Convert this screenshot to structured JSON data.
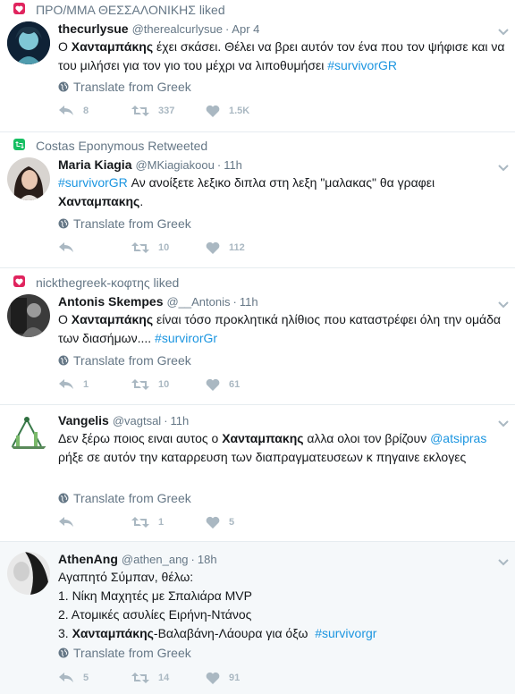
{
  "tweets": [
    {
      "context": "ΠΡΟ/ΜΜΑ ΘΕΣΣΑΛΟΝΙΚΗΣ liked",
      "context_type": "like",
      "name": "thecurlysue",
      "handle": "@therealcurlysue",
      "time": "Apr 4",
      "text_parts": [
        "Ο ",
        "Χανταμπάκης",
        " έχει σκάσει. Θέλει να βρει αυτόν τον ένα που τον ψήφισε και να του μιλήσει για τον γιο του μέχρι να λιποθυμήσει ",
        "#survivorGR"
      ],
      "translate": "Translate from Greek",
      "replies": "8",
      "retweets": "337",
      "likes": "1.5K"
    },
    {
      "context": "Costas Eponymous Retweeted",
      "context_type": "retweet",
      "name": "Maria Kiagia",
      "handle": "@MKiagiakoou",
      "time": "11h",
      "text_parts": [
        "#survivorGR",
        " Αν ανοίξετε λεξικο διπλα στη λεξη \"μαλακας\" θα γραφει ",
        "Χανταμπακης",
        "."
      ],
      "translate": "Translate from Greek",
      "replies": "",
      "retweets": "10",
      "likes": "112"
    },
    {
      "context": "nickthegreek-κοφτης liked",
      "context_type": "like",
      "name": "Antonis Skempes",
      "handle": "@__Antonis",
      "time": "11h",
      "text_parts": [
        "Ο ",
        "Χανταμπάκης",
        " είναι τόσο προκλητικά ηλίθιος που καταστρέφει όλη την ομάδα των διασήμων.... ",
        "#survirorGr"
      ],
      "translate": "Translate from Greek",
      "replies": "1",
      "retweets": "10",
      "likes": "61"
    },
    {
      "name": "Vangelis",
      "handle": "@vagtsal",
      "time": "11h",
      "text_parts": [
        "Δεν ξέρω ποιος ειναι αυτος ο ",
        "Χανταμπακης",
        " αλλα ολοι τον βρίζουν ",
        "@atsipras",
        " ρήξε σε αυτόν την καταρρευση των διαπραγματευσεων κ πηγαινε εκλογες"
      ],
      "translate": "Translate from Greek",
      "replies": "",
      "retweets": "1",
      "likes": "5"
    },
    {
      "name": "AthenAng",
      "handle": "@athen_ang",
      "time": "18h",
      "lines": {
        "l1": "Αγαπητό Σύμπαν, θέλω:",
        "l2": "1. Νίκη Μαχητές με Σπαλιάρα MVP",
        "l3": "2. Ατομικές ασυλίες Ειρήνη-Ντάνος",
        "l4_bold": "Χανταμπάκης",
        "l4_prefix": "3. ",
        "l4_rest": "-Βαλαβάνη-Λάουρα για όξω  ",
        "l4_tag": "#survivorgr"
      },
      "translate": "Translate from Greek",
      "replies": "5",
      "retweets": "14",
      "likes": "91"
    }
  ],
  "colors": {
    "like_badge": "#e0245e",
    "retweet_badge": "#17bf63",
    "link": "#1b95e0",
    "muted": "#657786",
    "action_gray": "#aab8c2"
  },
  "icons": [
    "heart-icon",
    "retweet-icon",
    "reply-icon",
    "globe-icon",
    "chevron-down-icon"
  ]
}
